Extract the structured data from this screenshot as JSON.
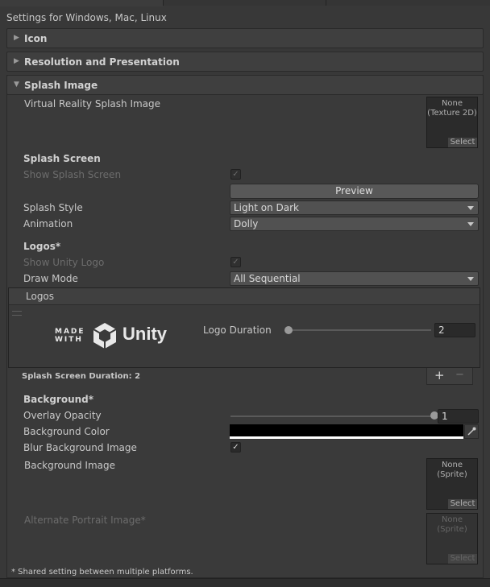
{
  "header": {
    "text": "Settings for Windows, Mac, Linux"
  },
  "sections": {
    "icon": "Icon",
    "resolution": "Resolution and Presentation",
    "splash": "Splash Image"
  },
  "vr_splash": {
    "label": "Virtual Reality Splash Image",
    "texture_name": "None\n(Texture 2D)",
    "select_label": "Select"
  },
  "splash_screen": {
    "heading": "Splash Screen",
    "show_label": "Show Splash Screen",
    "show_checked": true,
    "preview_label": "Preview",
    "style_label": "Splash Style",
    "style_value": "Light on Dark",
    "animation_label": "Animation",
    "animation_value": "Dolly"
  },
  "logos": {
    "heading": "Logos*",
    "show_unity_label": "Show Unity Logo",
    "show_unity_checked": true,
    "draw_mode_label": "Draw Mode",
    "draw_mode_value": "All Sequential",
    "list_header": "Logos",
    "logo_made": "MADE",
    "logo_with": "WITH",
    "logo_unity": "Unity",
    "duration_label": "Logo Duration",
    "duration_value": "2",
    "duration_fraction": 0.0
  },
  "splash_duration": "Splash Screen Duration: 2",
  "add_label": "+",
  "remove_label": "−",
  "background": {
    "heading": "Background*",
    "opacity_label": "Overlay Opacity",
    "opacity_value": "1",
    "opacity_fraction": 1.0,
    "color_label": "Background Color",
    "color_value": "#000000",
    "blur_label": "Blur Background Image",
    "blur_checked": true,
    "image_label": "Background Image",
    "image_name": "None (Sprite)",
    "image_select": "Select",
    "portrait_label": "Alternate Portrait Image*",
    "portrait_name": "None (Sprite)",
    "portrait_select": "Select"
  },
  "footnote": "* Shared setting between multiple platforms.",
  "checkmark": "✓",
  "colors": {
    "background": "#383838",
    "panel": "#3a3a3a",
    "text": "#c8c8c8",
    "dim": "#6c6c6c"
  }
}
